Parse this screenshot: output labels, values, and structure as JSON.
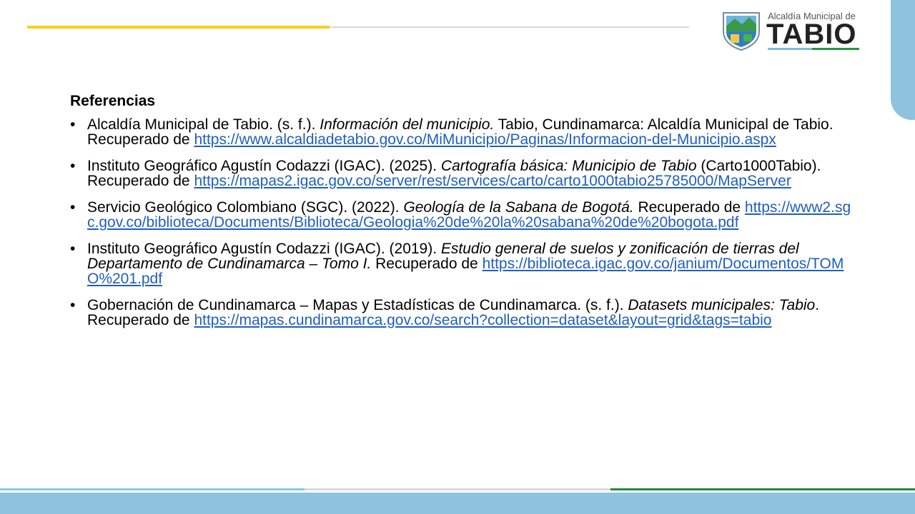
{
  "logo": {
    "small_text": "Alcaldía Municipal de",
    "big_text": "TABIO"
  },
  "heading": "Referencias",
  "refs": [
    {
      "pre": "Alcaldía Municipal de Tabio. (s. f.). ",
      "title": "Información del municipio.",
      "post": " Tabio, Cundinamarca: Alcaldía Municipal de Tabio. Recuperado de ",
      "url": "https://www.alcaldiadetabio.gov.co/MiMunicipio/Paginas/Informacion-del-Municipio.aspx"
    },
    {
      "pre": "Instituto Geográfico Agustín Codazzi (IGAC). (2025). ",
      "title": "Cartografía básica: Municipio de Tabio",
      "post": " (Carto1000Tabio). Recuperado de ",
      "url": "https://mapas2.igac.gov.co/server/rest/services/carto/carto1000tabio25785000/MapServer"
    },
    {
      "pre": "Servicio Geológico Colombiano (SGC). (2022). ",
      "title": "Geología de la Sabana de Bogotá.",
      "post": " Recuperado de ",
      "url": "https://www2.sgc.gov.co/biblioteca/Documents/Biblioteca/Geologia%20de%20la%20sabana%20de%20bogota.pdf"
    },
    {
      "pre": "Instituto Geográfico Agustín Codazzi (IGAC). (2019). ",
      "title": "Estudio general de suelos y zonificación de tierras del Departamento de Cundinamarca – Tomo I.",
      "post": " Recuperado de ",
      "url": "https://biblioteca.igac.gov.co/janium/Documentos/TOMO%201.pdf"
    },
    {
      "pre": "Gobernación de Cundinamarca – Mapas y Estadísticas de Cundinamarca. (s. f.). ",
      "title": "Datasets municipales: Tabio",
      "post": ". Recuperado de ",
      "url": "https://mapas.cundinamarca.gov.co/search?collection=dataset&layout=grid&tags=tabio"
    }
  ],
  "colors": {
    "accent_yellow": "#f7d117",
    "accent_blue": "#8ec3e0",
    "accent_green": "#1f8a3a",
    "link": "#1f5fbf"
  }
}
